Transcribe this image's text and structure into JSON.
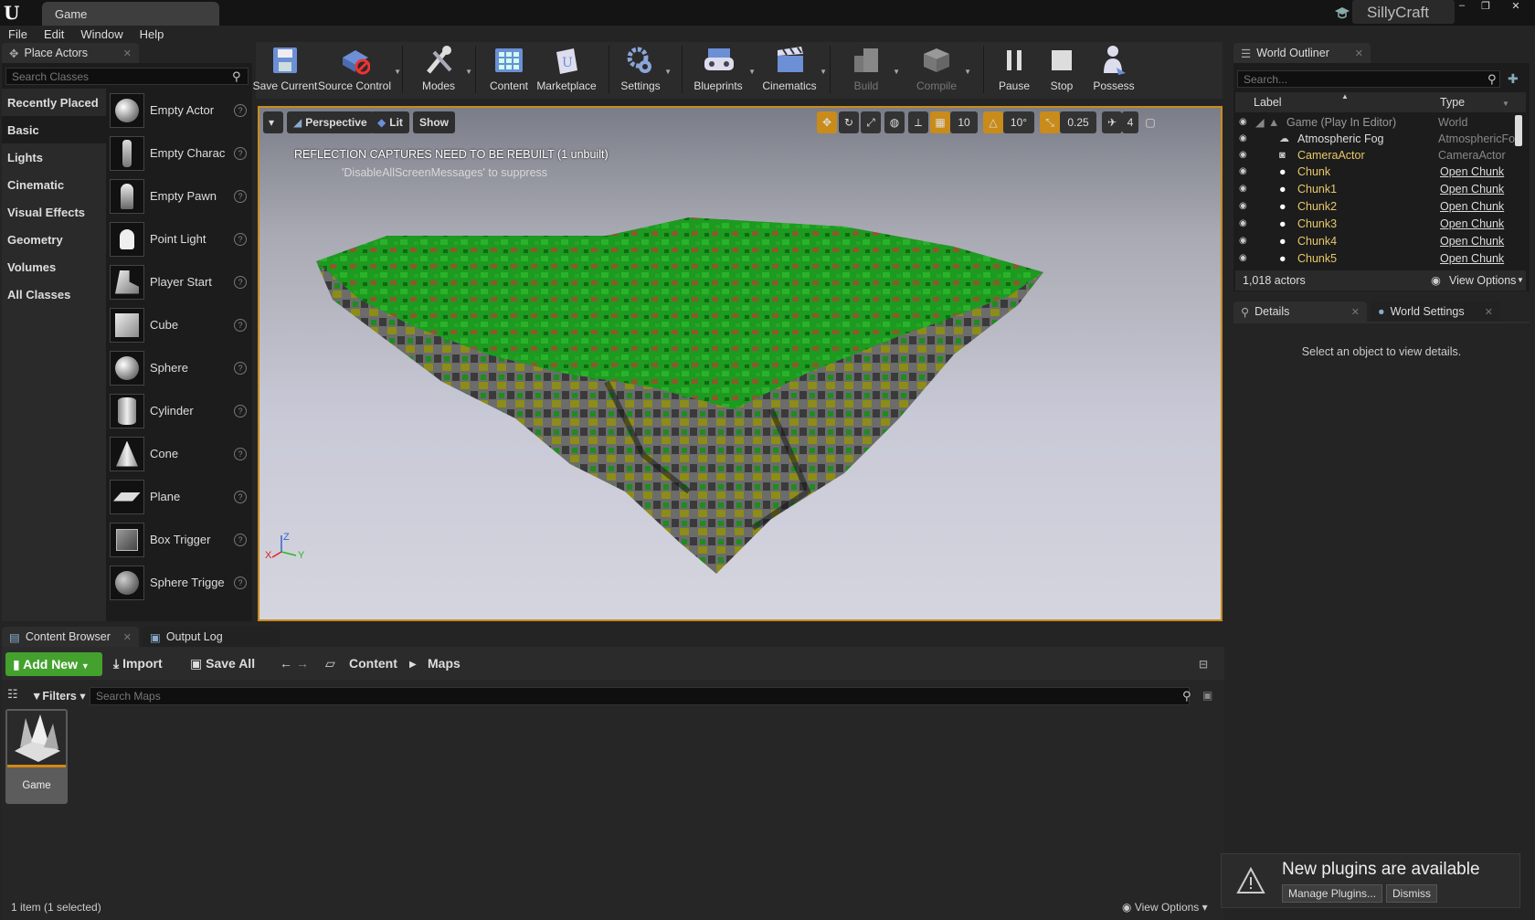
{
  "window": {
    "tab_title": "Game",
    "project_name": "SillyCraft",
    "controls": [
      "‒",
      "❐",
      "✕"
    ]
  },
  "menu": [
    "File",
    "Edit",
    "Window",
    "Help"
  ],
  "place_actors": {
    "tab_label": "Place Actors",
    "search_placeholder": "Search Classes",
    "categories": [
      "Recently Placed",
      "Basic",
      "Lights",
      "Cinematic",
      "Visual Effects",
      "Geometry",
      "Volumes",
      "All Classes"
    ],
    "selected_category": "Basic",
    "actors": [
      "Empty Actor",
      "Empty Charac",
      "Empty Pawn",
      "Point Light",
      "Player Start",
      "Cube",
      "Sphere",
      "Cylinder",
      "Cone",
      "Plane",
      "Box Trigger",
      "Sphere Trigge"
    ]
  },
  "toolbar": {
    "items": [
      {
        "label": "Save Current"
      },
      {
        "label": "Source Control"
      },
      {
        "label": "Modes"
      },
      {
        "label": "Content"
      },
      {
        "label": "Marketplace"
      },
      {
        "label": "Settings"
      },
      {
        "label": "Blueprints"
      },
      {
        "label": "Cinematics"
      },
      {
        "label": "Build"
      },
      {
        "label": "Compile"
      },
      {
        "label": "Pause"
      },
      {
        "label": "Stop"
      },
      {
        "label": "Possess"
      }
    ]
  },
  "viewport": {
    "view_mode": "Perspective",
    "lighting": "Lit",
    "show": "Show",
    "message_line1": "REFLECTION CAPTURES NEED TO BE REBUILT (1 unbuilt)",
    "message_line2": "'DisableAllScreenMessages' to suppress",
    "grid_snap": "10",
    "rotation_snap": "10°",
    "scale_snap": "0.25",
    "camera_speed": "4",
    "axis_labels": [
      "X",
      "Y",
      "Z"
    ]
  },
  "world_outliner": {
    "tab_label": "World Outliner",
    "search_placeholder": "Search...",
    "col_label": "Label",
    "col_type": "Type",
    "rows": [
      {
        "label": "Game (Play In Editor)",
        "type": "World"
      },
      {
        "label": "Atmospheric Fog",
        "type": "AtmosphericFo"
      },
      {
        "label": "CameraActor",
        "type": "CameraActor"
      },
      {
        "label": "Chunk",
        "type": "Open Chunk"
      },
      {
        "label": "Chunk1",
        "type": "Open Chunk"
      },
      {
        "label": "Chunk2",
        "type": "Open Chunk"
      },
      {
        "label": "Chunk3",
        "type": "Open Chunk"
      },
      {
        "label": "Chunk4",
        "type": "Open Chunk"
      },
      {
        "label": "Chunk5",
        "type": "Open Chunk"
      }
    ],
    "actor_count": "1,018 actors",
    "view_options": "View Options"
  },
  "details": {
    "tab_details": "Details",
    "tab_world_settings": "World Settings",
    "empty_text": "Select an object to view details."
  },
  "content_browser": {
    "tab_label": "Content Browser",
    "output_log_tab": "Output Log",
    "add_new": "Add New",
    "import": "Import",
    "save_all": "Save All",
    "path": [
      "Content",
      "Maps"
    ],
    "filters": "Filters",
    "search_placeholder": "Search Maps",
    "asset_name": "Game",
    "status": "1 item (1 selected)",
    "view_options": "View Options"
  },
  "notification": {
    "title": "New plugins are available",
    "manage": "Manage Plugins...",
    "dismiss": "Dismiss"
  },
  "colors": {
    "accent": "#c98b1a",
    "add_green": "#44a12e",
    "actor_yellow": "#e8c86a"
  }
}
